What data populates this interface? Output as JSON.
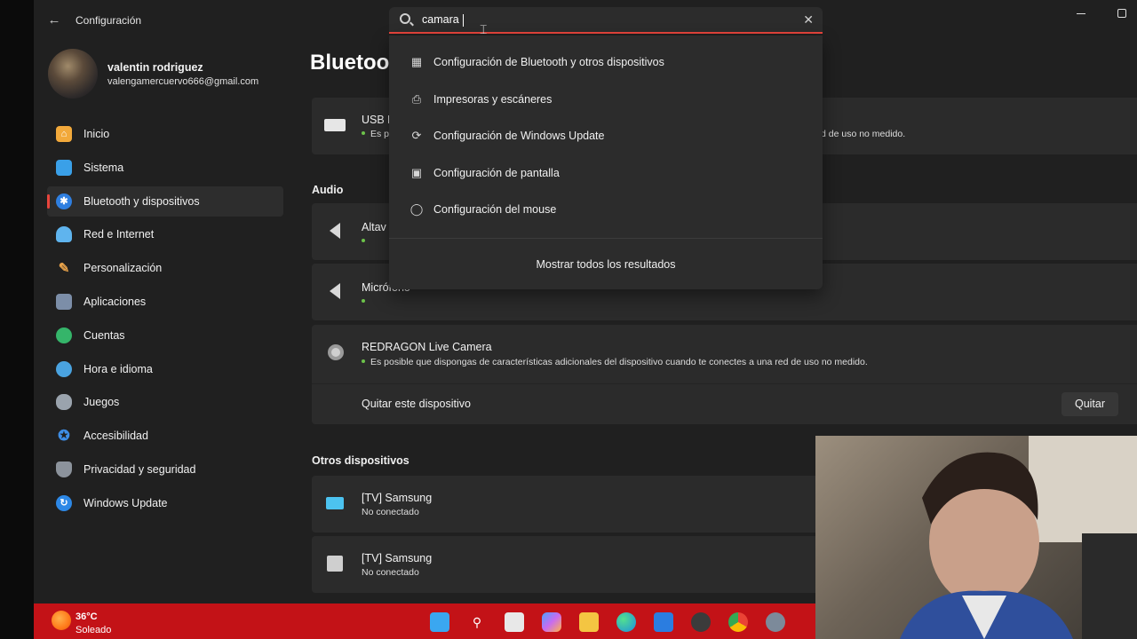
{
  "window": {
    "title": "Configuración"
  },
  "user": {
    "name": "valentin rodriguez",
    "email": "valengamercuervo666@gmail.com"
  },
  "nav": [
    {
      "label": "Inicio",
      "icon": "home-icon",
      "color": "#f2a93b"
    },
    {
      "label": "Sistema",
      "icon": "monitor-icon",
      "color": "#3aa0e8"
    },
    {
      "label": "Bluetooth y dispositivos",
      "icon": "bluetooth-icon",
      "color": "#2f7fe0"
    },
    {
      "label": "Red e Internet",
      "icon": "wifi-icon",
      "color": "#5fb4ee"
    },
    {
      "label": "Personalización",
      "icon": "brush-icon",
      "color": "#e8a24a"
    },
    {
      "label": "Aplicaciones",
      "icon": "apps-icon",
      "color": "#7c8ea8"
    },
    {
      "label": "Cuentas",
      "icon": "person-icon",
      "color": "#35b56a"
    },
    {
      "label": "Hora e idioma",
      "icon": "globe-clock-icon",
      "color": "#4aa3e0"
    },
    {
      "label": "Juegos",
      "icon": "gamepad-icon",
      "color": "#9aa3ad"
    },
    {
      "label": "Accesibilidad",
      "icon": "accessibility-icon",
      "color": "#3e8ee6"
    },
    {
      "label": "Privacidad y seguridad",
      "icon": "shield-icon",
      "color": "#8c939c"
    },
    {
      "label": "Windows Update",
      "icon": "update-icon",
      "color": "#2d88e6"
    }
  ],
  "nav_active": "Bluetooth y dispositivos",
  "main": {
    "page_title": "Bluetoo",
    "usb_card": {
      "title": "USB K",
      "sub_left": "Es p",
      "sub_right": "d de uso no medido."
    },
    "audio_label": "Audio",
    "speaker_card": {
      "title": "Altav"
    },
    "mic_card": {
      "title": "Micrófono"
    },
    "camera_card": {
      "title": "REDRAGON  Live Camera",
      "sub": "Es posible que dispongas de características adicionales del dispositivo cuando te conectes a una red de uso no medido.",
      "remove_label": "Quitar este dispositivo",
      "remove_button": "Quitar"
    },
    "other_label": "Otros dispositivos",
    "tv1": {
      "title": "[TV] Samsung",
      "sub": "No conectado"
    },
    "tv2": {
      "title": "[TV] Samsung",
      "sub": "No conectado"
    }
  },
  "search": {
    "value": "camara",
    "results": [
      {
        "label": "Configuración de Bluetooth y otros dispositivos",
        "icon": "devices-icon"
      },
      {
        "label": "Impresoras y escáneres",
        "icon": "printer-icon"
      },
      {
        "label": "Configuración de Windows Update",
        "icon": "sync-icon"
      },
      {
        "label": "Configuración de pantalla",
        "icon": "laptop-icon"
      },
      {
        "label": "Configuración del mouse",
        "icon": "mouse-icon"
      }
    ],
    "show_all": "Mostrar todos los resultados"
  },
  "taskbar": {
    "weather_temp": "36°C",
    "weather_cond": "Soleado",
    "icons": [
      "start-icon",
      "search-icon",
      "task-view-icon",
      "copilot-icon",
      "file-explorer-icon",
      "edge-icon",
      "mail-icon",
      "app-icon",
      "chrome-icon",
      "settings-icon"
    ]
  }
}
